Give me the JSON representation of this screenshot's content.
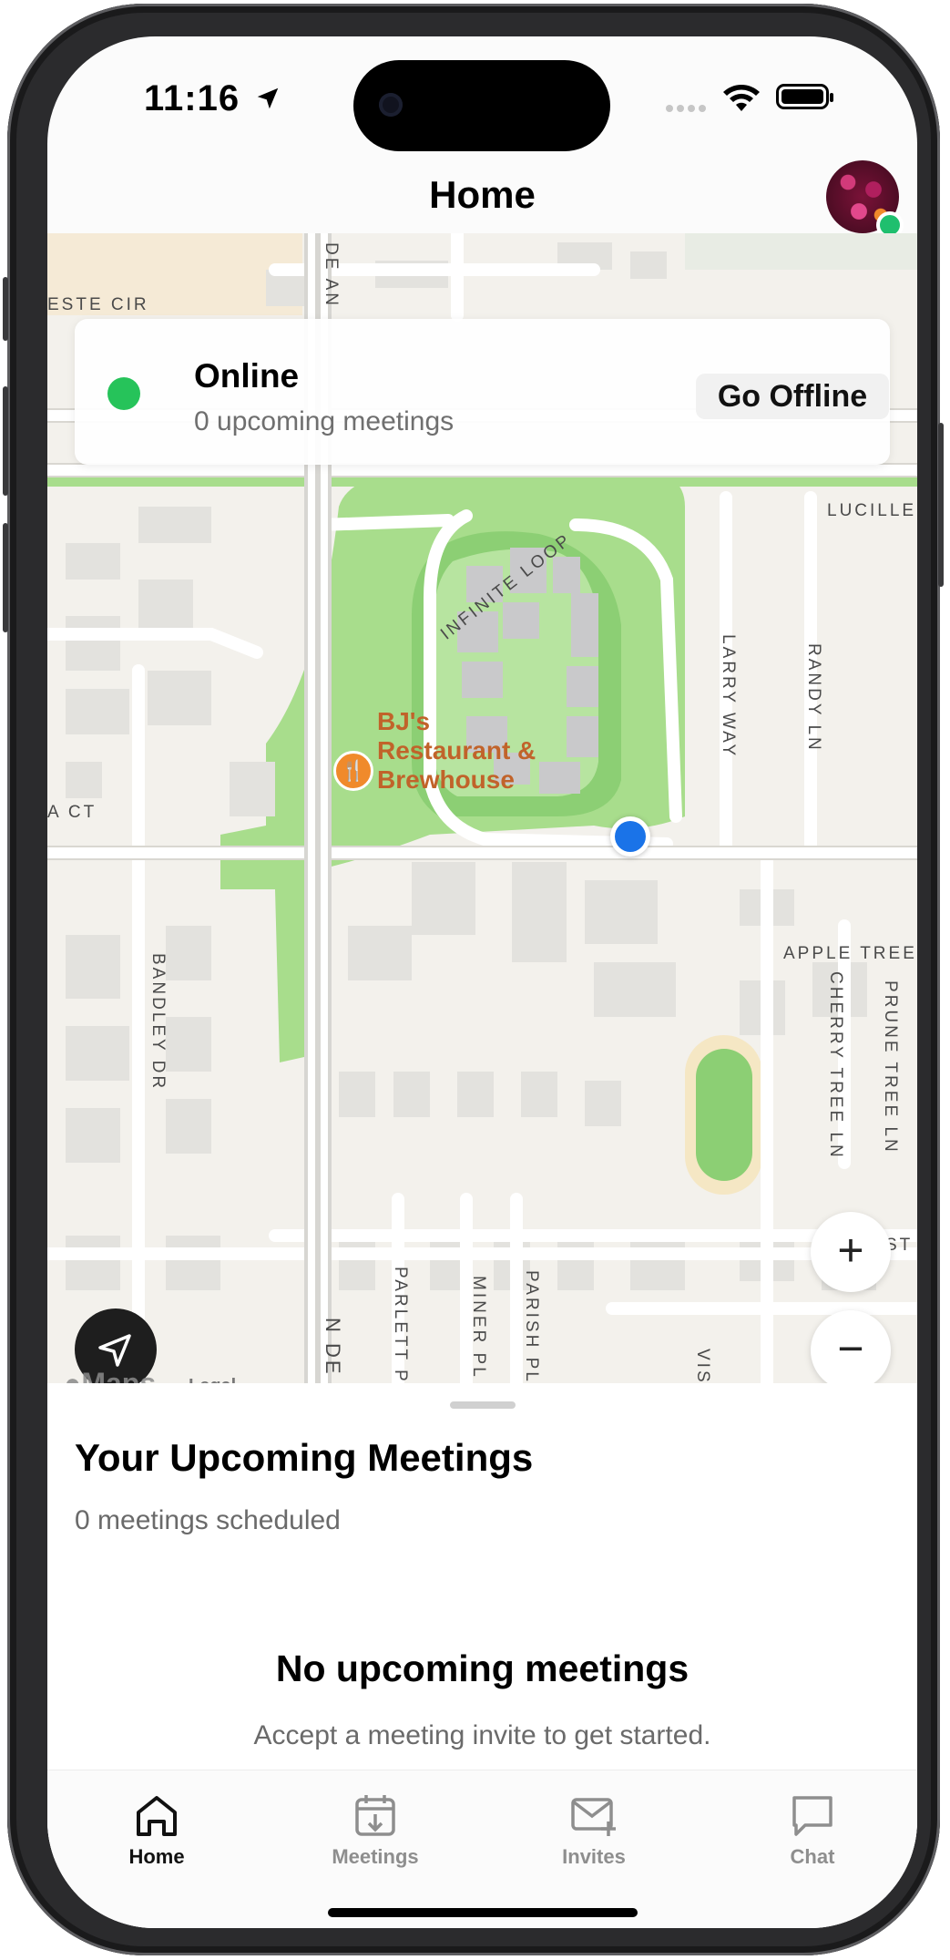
{
  "status_bar": {
    "time": "11:16"
  },
  "header": {
    "title": "Home"
  },
  "status_card": {
    "title": "Online",
    "subtitle": "0 upcoming meetings",
    "button_label": "Go Offline"
  },
  "map": {
    "poi_name_line1": "BJ's",
    "poi_name_line2": "Restaurant &",
    "poi_name_line3": "Brewhouse",
    "labels": {
      "este_cir": "ESTE CIR",
      "de_an": "DE AN",
      "lucille": "LUCILLE",
      "infinite_loop": "INFINITE LOOP",
      "larry_way": "LARRY WAY",
      "randy_ln": "RANDY LN",
      "a_ct": "A CT",
      "bandley_dr": "BANDLEY DR",
      "apple_tree": "APPLE TREE",
      "cherry_tree_ln": "CHERRY TREE LN",
      "prune_tree_ln": "PRUNE TREE LN",
      "parlett_pl": "PARLETT PL",
      "miner_pl": "MINER PL",
      "parish_pl": "PARISH PL",
      "n_de_an": "N DE AN",
      "vis": "VIS",
      "st": "ST"
    },
    "attribution": "Maps",
    "legal": "Legal",
    "zoom_in": "+",
    "zoom_out": "−"
  },
  "meetings_sheet": {
    "title": "Your Upcoming Meetings",
    "subtitle": "0 meetings scheduled",
    "empty_title": "No upcoming meetings",
    "empty_subtitle": "Accept a meeting invite to get started."
  },
  "tabs": [
    {
      "label": "Home",
      "icon": "house-icon",
      "active": true
    },
    {
      "label": "Meetings",
      "icon": "calendar-icon",
      "active": false
    },
    {
      "label": "Invites",
      "icon": "envelope-plus-icon",
      "active": false
    },
    {
      "label": "Chat",
      "icon": "chat-bubble-icon",
      "active": false
    }
  ],
  "colors": {
    "online_green": "#26c35a",
    "user_location_blue": "#1a73e8",
    "park_green": "#a8dd8c",
    "poi_orange": "#f08a2b"
  }
}
